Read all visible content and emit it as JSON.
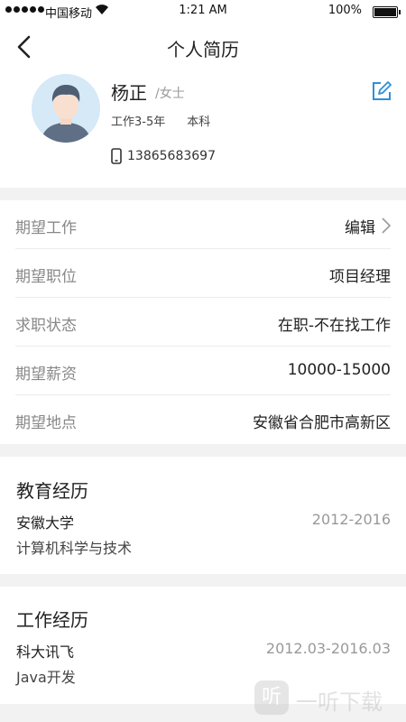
{
  "status_bar": {
    "carrier": "中国移动",
    "time": "1:21 AM",
    "battery": "100%"
  },
  "header": {
    "title": "个人简历"
  },
  "profile": {
    "name": "杨正",
    "gender": "/女士",
    "experience": "工作3-5年",
    "education": "本科",
    "phone": "13865683697"
  },
  "expectations": [
    {
      "label": "期望工作",
      "value": "编辑"
    },
    {
      "label": "期望职位",
      "value": "项目经理"
    },
    {
      "label": "求职状态",
      "value": "在职-不在找工作"
    },
    {
      "label": "期望薪资",
      "value": "10000-15000"
    },
    {
      "label": "期望地点",
      "value": "安徽省合肥市高新区"
    }
  ],
  "education": {
    "title": "教育经历",
    "school": "安徽大学",
    "period": "2012-2016",
    "major": "计算机科学与技术"
  },
  "work": {
    "title": "工作经历",
    "company": "科大讯飞",
    "period": "2012.03-2016.03",
    "role": "Java开发"
  },
  "watermark": {
    "logo": "听",
    "text": "一听下载"
  },
  "colors": {
    "accent": "#2f8fd8",
    "divider": "#f2f2f2",
    "label": "#888888"
  }
}
